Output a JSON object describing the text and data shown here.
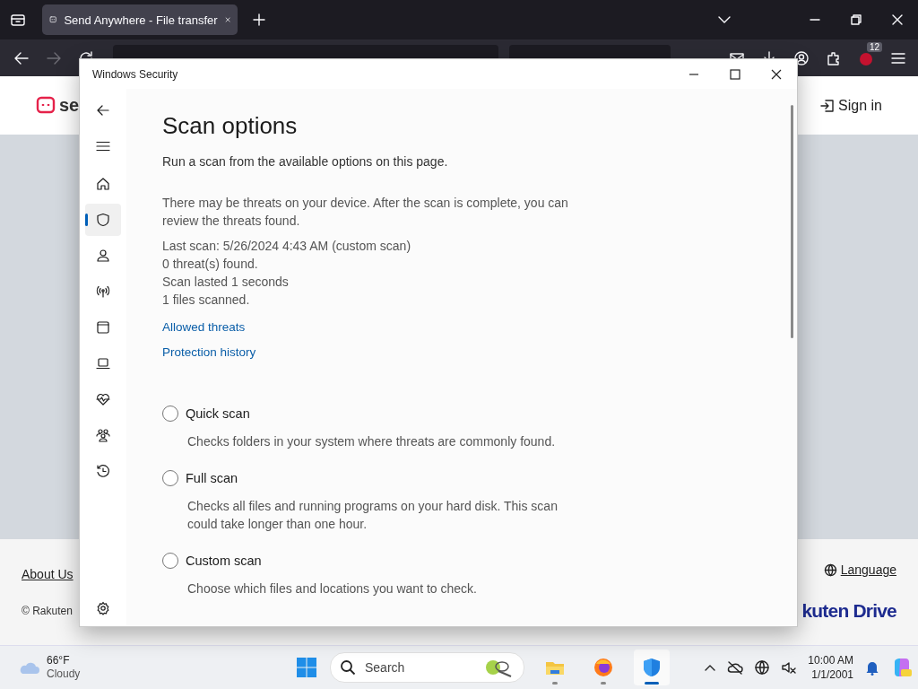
{
  "browser": {
    "tabs": [
      {
        "title": "Send Anywhere - File transfer",
        "selected": true
      }
    ],
    "extension_badge": "12"
  },
  "web_page": {
    "logo_text": "se",
    "sign_in": "Sign in",
    "footer_link": "About Us",
    "copyright": "© Rakuten",
    "language": "Language",
    "brand": "kuten Drive"
  },
  "dialog": {
    "title": "Windows Security",
    "nav_items": [
      {
        "kind": "home",
        "selected": false
      },
      {
        "kind": "shield",
        "selected": true
      },
      {
        "kind": "person",
        "selected": false
      },
      {
        "kind": "antenna",
        "selected": false
      },
      {
        "kind": "browser",
        "selected": false
      },
      {
        "kind": "laptop",
        "selected": false
      },
      {
        "kind": "heart",
        "selected": false
      },
      {
        "kind": "family",
        "selected": false
      },
      {
        "kind": "history",
        "selected": false
      }
    ],
    "heading": "Scan options",
    "subtitle": "Run a scan from the available options on this page.",
    "info": "There may be threats on your device. After the scan is complete, you can review the threats found.",
    "scan_details": [
      "Last scan: 5/26/2024 4:43 AM (custom scan)",
      "0 threat(s) found.",
      "Scan lasted 1 seconds",
      "1 files scanned."
    ],
    "links": [
      "Allowed threats",
      "Protection history"
    ],
    "scan_types": [
      {
        "label": "Quick scan",
        "description": "Checks folders in your system where threats are commonly found.",
        "selected": false
      },
      {
        "label": "Full scan",
        "description": "Checks all files and running programs on your hard disk. This scan could take longer than one hour.",
        "selected": false
      },
      {
        "label": "Custom scan",
        "description": "Choose which files and locations you want to check.",
        "selected": false
      }
    ]
  },
  "taskbar": {
    "temperature": "66°F",
    "weather": "Cloudy",
    "search_placeholder": "Search",
    "time": "10:00 AM",
    "date": "1/1/2001",
    "pinned": [
      {
        "kind": "folder",
        "selected": false
      },
      {
        "kind": "firefox",
        "selected": false
      },
      {
        "kind": "shield",
        "selected": true
      }
    ]
  }
}
